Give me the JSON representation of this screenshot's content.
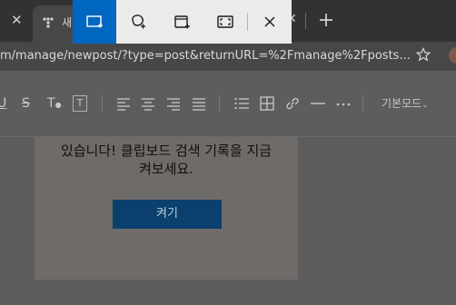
{
  "browser": {
    "tab_title": "새",
    "url": "m/manage/newpost/?type=post&returnURL=%2Fmanage%2Fposts..."
  },
  "editor": {
    "mode_label": "기본모드",
    "toolbar_icons": [
      "underline-icon",
      "strikethrough-icon",
      "text-color-icon",
      "text-background-icon",
      "align-left-icon",
      "align-center-icon",
      "align-right-icon",
      "align-justify-icon",
      "bullet-list-icon",
      "table-icon",
      "link-icon",
      "horizontal-rule-icon",
      "more-icon"
    ]
  },
  "clipboard_panel": {
    "line1": "있습니다! 클립보드 검색 기록을 지금",
    "line2": "켜보세요.",
    "button_label": "켜기"
  },
  "snip_toolbar": {
    "modes": [
      "rectangle-snip-icon",
      "freeform-snip-icon",
      "window-snip-icon",
      "fullscreen-snip-icon",
      "close-icon"
    ],
    "active_mode": "rectangle-snip-icon",
    "accent_color": "#0067c0"
  }
}
